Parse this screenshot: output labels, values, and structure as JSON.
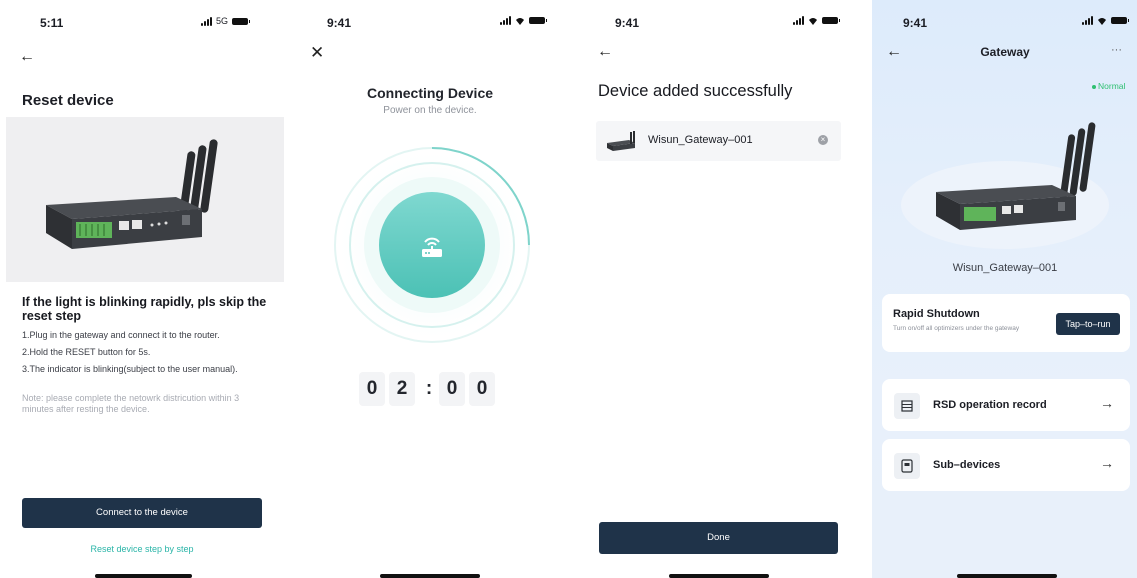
{
  "status_bars": {
    "p1_time": "5:11",
    "p1_network": "5G",
    "p2_time": "9:41",
    "p3_time": "9:41",
    "p4_time": "9:41"
  },
  "reset_screen": {
    "title": "Reset device",
    "step_heading": "If the light is blinking rapidly, pls skip the reset step",
    "steps": [
      "1.Plug in the gateway and connect it to the router.",
      "2.Hold the RESET button for 5s.",
      "3.The indicator is blinking(subject to the user manual)."
    ],
    "note": "Note: please complete the netowrk districution within 3 minutes after resting the device.",
    "connect_button": "Connect to the device",
    "step_link": "Reset device step by step"
  },
  "connecting_screen": {
    "title": "Connecting Device",
    "subtitle": "Power on the device.",
    "timer_digits": [
      "0",
      "2",
      "0",
      "0"
    ],
    "timer_separator": ":"
  },
  "success_screen": {
    "title": "Device added successfully",
    "device_name": "Wisun_Gateway–001",
    "done_button": "Done"
  },
  "gateway_screen": {
    "title": "Gateway",
    "more": "···",
    "status": "Normal",
    "status_color": "#2fbf71",
    "device_name": "Wisun_Gateway–001",
    "rapid_shutdown_title": "Rapid Shutdown",
    "rapid_shutdown_desc": "Turn on/off all optimizers under the gateway",
    "tap_button": "Tap–to–run",
    "menu": [
      {
        "label": "RSD operation record",
        "icon": "list-icon"
      },
      {
        "label": "Sub–devices",
        "icon": "devices-icon"
      }
    ]
  },
  "colors": {
    "primary_dark": "#1f3349",
    "accent_teal": "#2bb5a8"
  }
}
